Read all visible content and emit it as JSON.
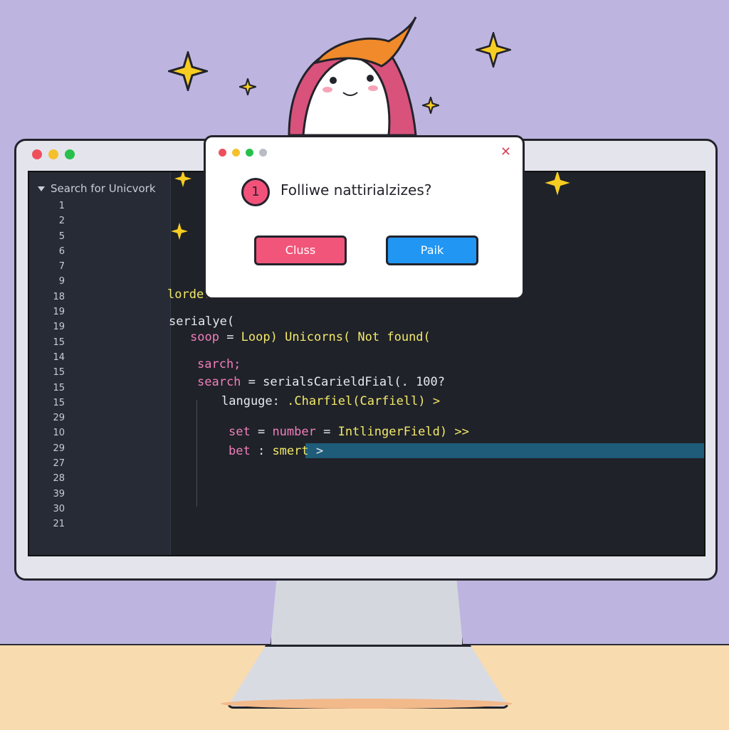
{
  "colors": {
    "background": "#bdb5e0",
    "desk": "#f8dcaf",
    "window_close": "#ef4f5d",
    "window_minimize": "#f5c02c",
    "window_maximize": "#27c04a",
    "accent_pink": "#f2557a",
    "accent_blue": "#2196f3"
  },
  "editor": {
    "search_label": "Search for Unicvork",
    "line_numbers": [
      "1",
      "2",
      "5",
      "6",
      "7",
      "9",
      "18",
      "19",
      "19",
      "15",
      "14",
      "15",
      "15",
      "15",
      "29",
      "10",
      "29",
      "27",
      "28",
      "39",
      "30",
      "21"
    ],
    "code_lines": [
      {
        "text": "lorde:",
        "cls": "k-yellow"
      },
      {
        "text": "serialye(",
        "cls": "k-white"
      },
      {
        "text": "soop",
        "cls": "k-pink"
      },
      {
        "text": " = ",
        "cls": "k-white"
      },
      {
        "text": "Loop) Unicorns( Not found(",
        "cls": "k-yellow"
      },
      {
        "text": "sarch;",
        "cls": "k-pink"
      },
      {
        "text": "search",
        "cls": "k-pink"
      },
      {
        "text": " = serials",
        "cls": "k-white"
      },
      {
        "text": "CarieldFial(. 100?",
        "cls": "k-white"
      },
      {
        "text": "languge:",
        "cls": "k-white"
      },
      {
        "text": " .Charfiel(Carfiell) >",
        "cls": "k-yellow"
      },
      {
        "text": "set",
        "cls": "k-pink"
      },
      {
        "text": " = ",
        "cls": "k-white"
      },
      {
        "text": "number",
        "cls": "k-pink"
      },
      {
        "text": " = ",
        "cls": "k-white"
      },
      {
        "text": "IntlingerField) >>",
        "cls": "k-yellow"
      },
      {
        "text": "bet",
        "cls": "k-pink"
      },
      {
        "text": " : ",
        "cls": "k-white"
      },
      {
        "text": "smert",
        "cls": "k-yellow"
      },
      {
        "text": " >",
        "cls": "k-white"
      }
    ]
  },
  "dialog": {
    "badge": "1",
    "message": "Folliwe nattirialzizes?",
    "cancel_label": "Cluss",
    "ok_label": "Paik",
    "close_glyph": "✕"
  }
}
